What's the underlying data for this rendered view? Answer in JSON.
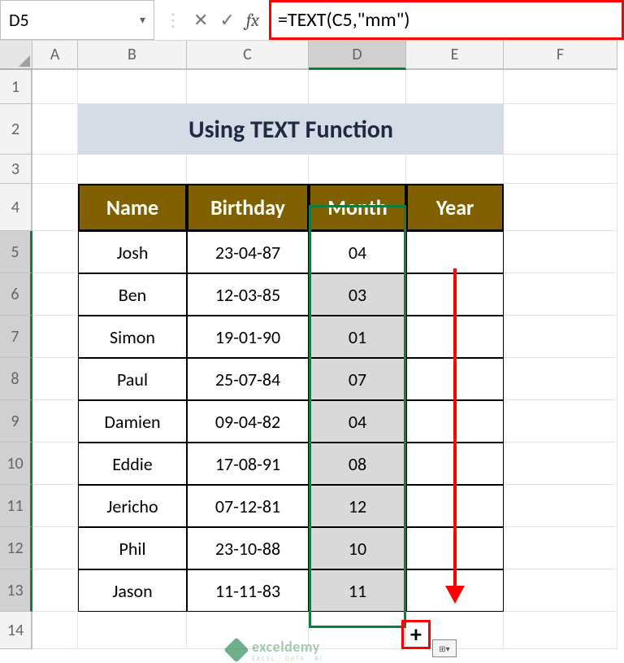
{
  "namebox": {
    "value": "D5"
  },
  "formula_bar": {
    "value": "=TEXT(C5,\"mm\")"
  },
  "columns": [
    "A",
    "B",
    "C",
    "D",
    "E",
    "F"
  ],
  "row_headers": [
    "1",
    "2",
    "3",
    "4",
    "5",
    "6",
    "7",
    "8",
    "9",
    "10",
    "11",
    "12",
    "13",
    "14"
  ],
  "title": "Using TEXT Function",
  "table": {
    "headers": {
      "name": "Name",
      "birthday": "Birthday",
      "month": "Month",
      "year": "Year"
    },
    "rows": [
      {
        "name": "Josh",
        "birthday": "23-04-87",
        "month": "04",
        "year": ""
      },
      {
        "name": "Ben",
        "birthday": "12-03-85",
        "month": "03",
        "year": ""
      },
      {
        "name": "Simon",
        "birthday": "19-01-90",
        "month": "01",
        "year": ""
      },
      {
        "name": "Paul",
        "birthday": "25-07-84",
        "month": "07",
        "year": ""
      },
      {
        "name": "Damien",
        "birthday": "09-04-82",
        "month": "04",
        "year": ""
      },
      {
        "name": "Eddie",
        "birthday": "17-08-91",
        "month": "08",
        "year": ""
      },
      {
        "name": "Jericho",
        "birthday": "07-12-81",
        "month": "12",
        "year": ""
      },
      {
        "name": "Phil",
        "birthday": "23-10-88",
        "month": "10",
        "year": ""
      },
      {
        "name": "Jason",
        "birthday": "11-11-83",
        "month": "11",
        "year": ""
      }
    ]
  },
  "watermark": {
    "brand": "exceldemy",
    "tagline": "EXCEL · DATA · BI"
  }
}
